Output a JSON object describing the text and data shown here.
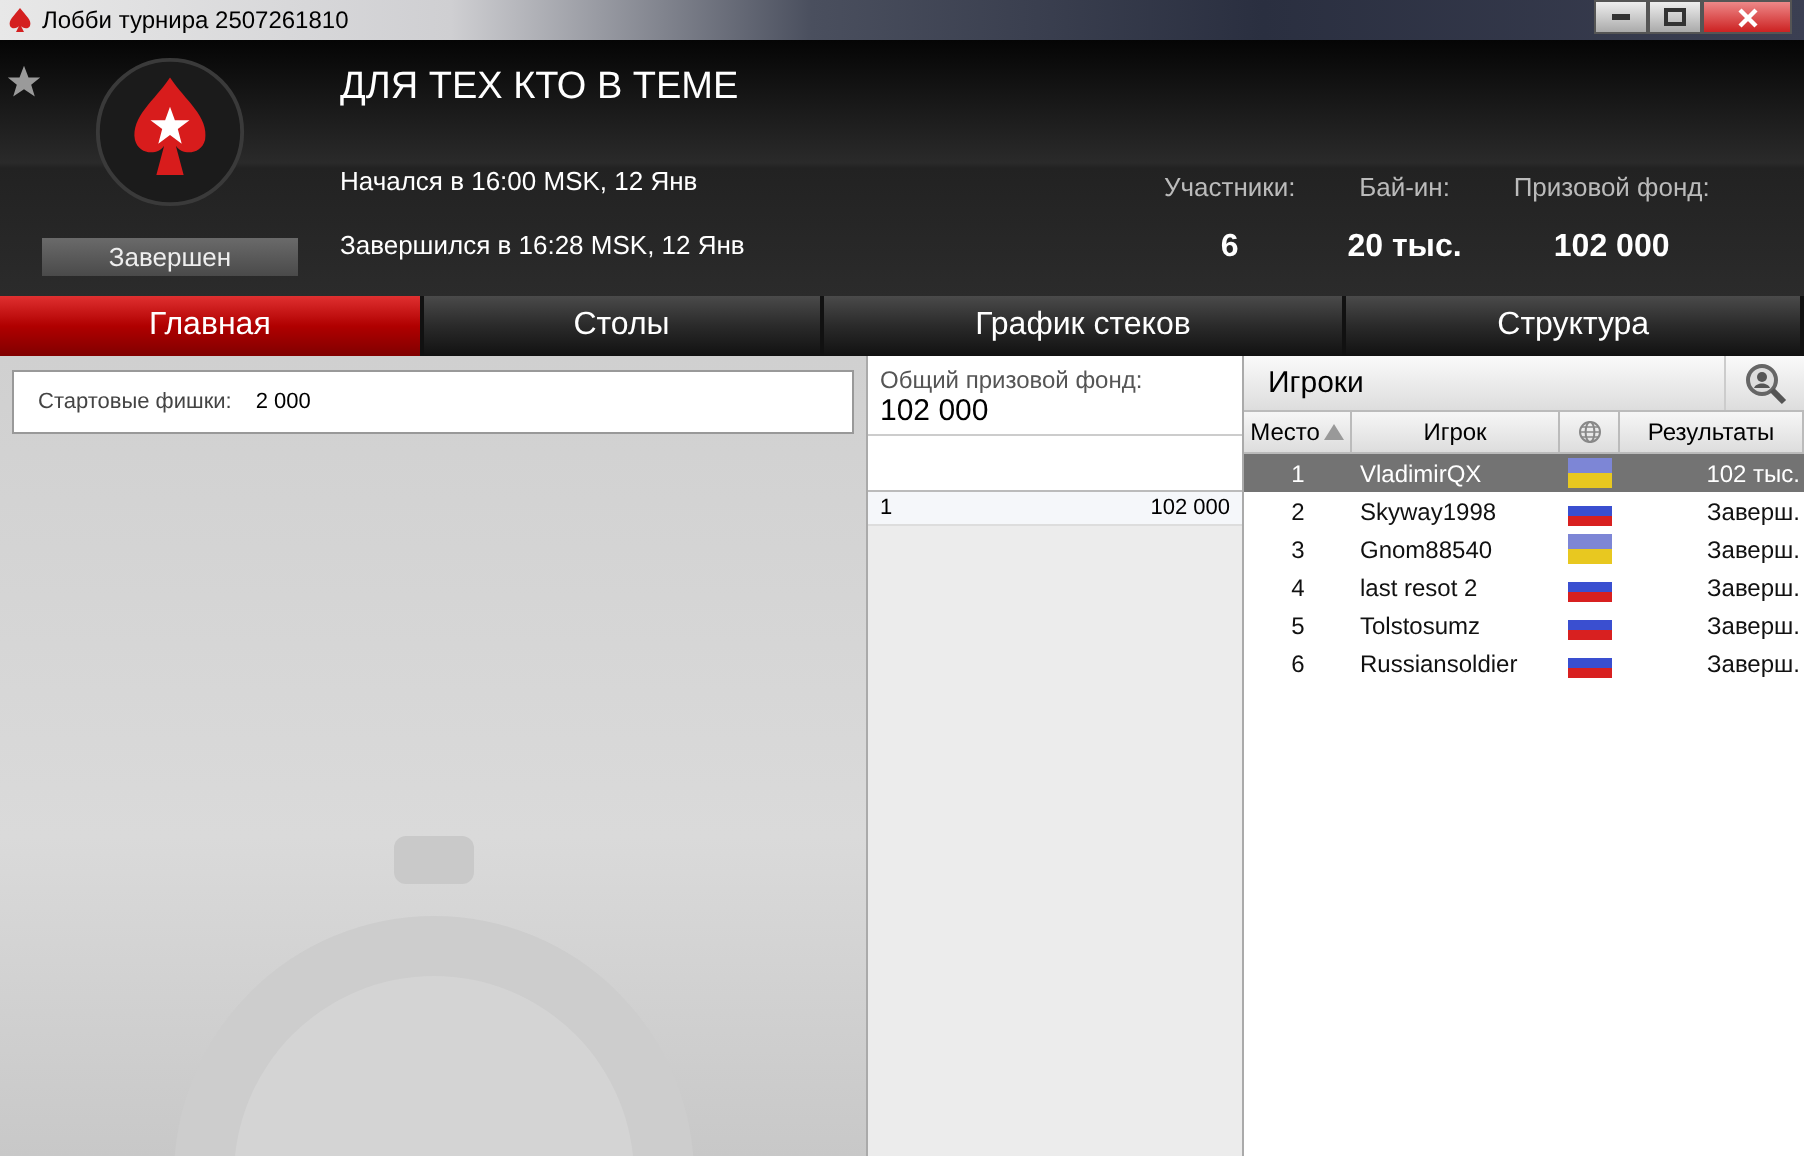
{
  "window": {
    "title": "Лобби турнира 2507261810"
  },
  "header": {
    "tournament_name": "ДЛЯ ТЕХ КТО В ТЕМЕ",
    "status": "Завершен",
    "started": "Начался в 16:00 MSK, 12 Янв",
    "finished": "Завершился в 16:28 MSK, 12 Янв",
    "stats": [
      {
        "label": "Участники:",
        "value": "6"
      },
      {
        "label": "Бай-ин:",
        "value": "20 тыс."
      },
      {
        "label": "Призовой фонд:",
        "value": "102 000"
      }
    ]
  },
  "tabs": [
    {
      "label": "Главная",
      "selected": true
    },
    {
      "label": "Столы",
      "selected": false
    },
    {
      "label": "График стеков",
      "selected": false
    },
    {
      "label": "Структура",
      "selected": false
    }
  ],
  "info": {
    "label": "Стартовые фишки:",
    "value": "2 000"
  },
  "prize_pool": {
    "label": "Общий призовой фонд:",
    "value": "102 000",
    "rows": [
      {
        "place": "1",
        "amount": "102 000"
      }
    ]
  },
  "players": {
    "title": "Игроки",
    "columns": [
      "Место",
      "Игрок",
      "Результаты"
    ],
    "rows": [
      {
        "place": "1",
        "name": "VladimirQX",
        "kind": "ukraine",
        "result": "102 тыс.",
        "selected": true
      },
      {
        "place": "2",
        "name": "Skyway1998",
        "kind": "russia",
        "result": "Заверш.",
        "selected": false
      },
      {
        "place": "3",
        "name": "Gnom88540",
        "kind": "ukraine",
        "result": "Заверш.",
        "selected": false
      },
      {
        "place": "4",
        "name": "last resot 2",
        "kind": "russia",
        "result": "Заверш.",
        "selected": false
      },
      {
        "place": "5",
        "name": "Tolstosumz",
        "kind": "russia",
        "result": "Заверш.",
        "selected": false
      },
      {
        "place": "6",
        "name": "Russiansoldier",
        "kind": "russia",
        "result": "Заверш.",
        "selected": false
      }
    ]
  }
}
